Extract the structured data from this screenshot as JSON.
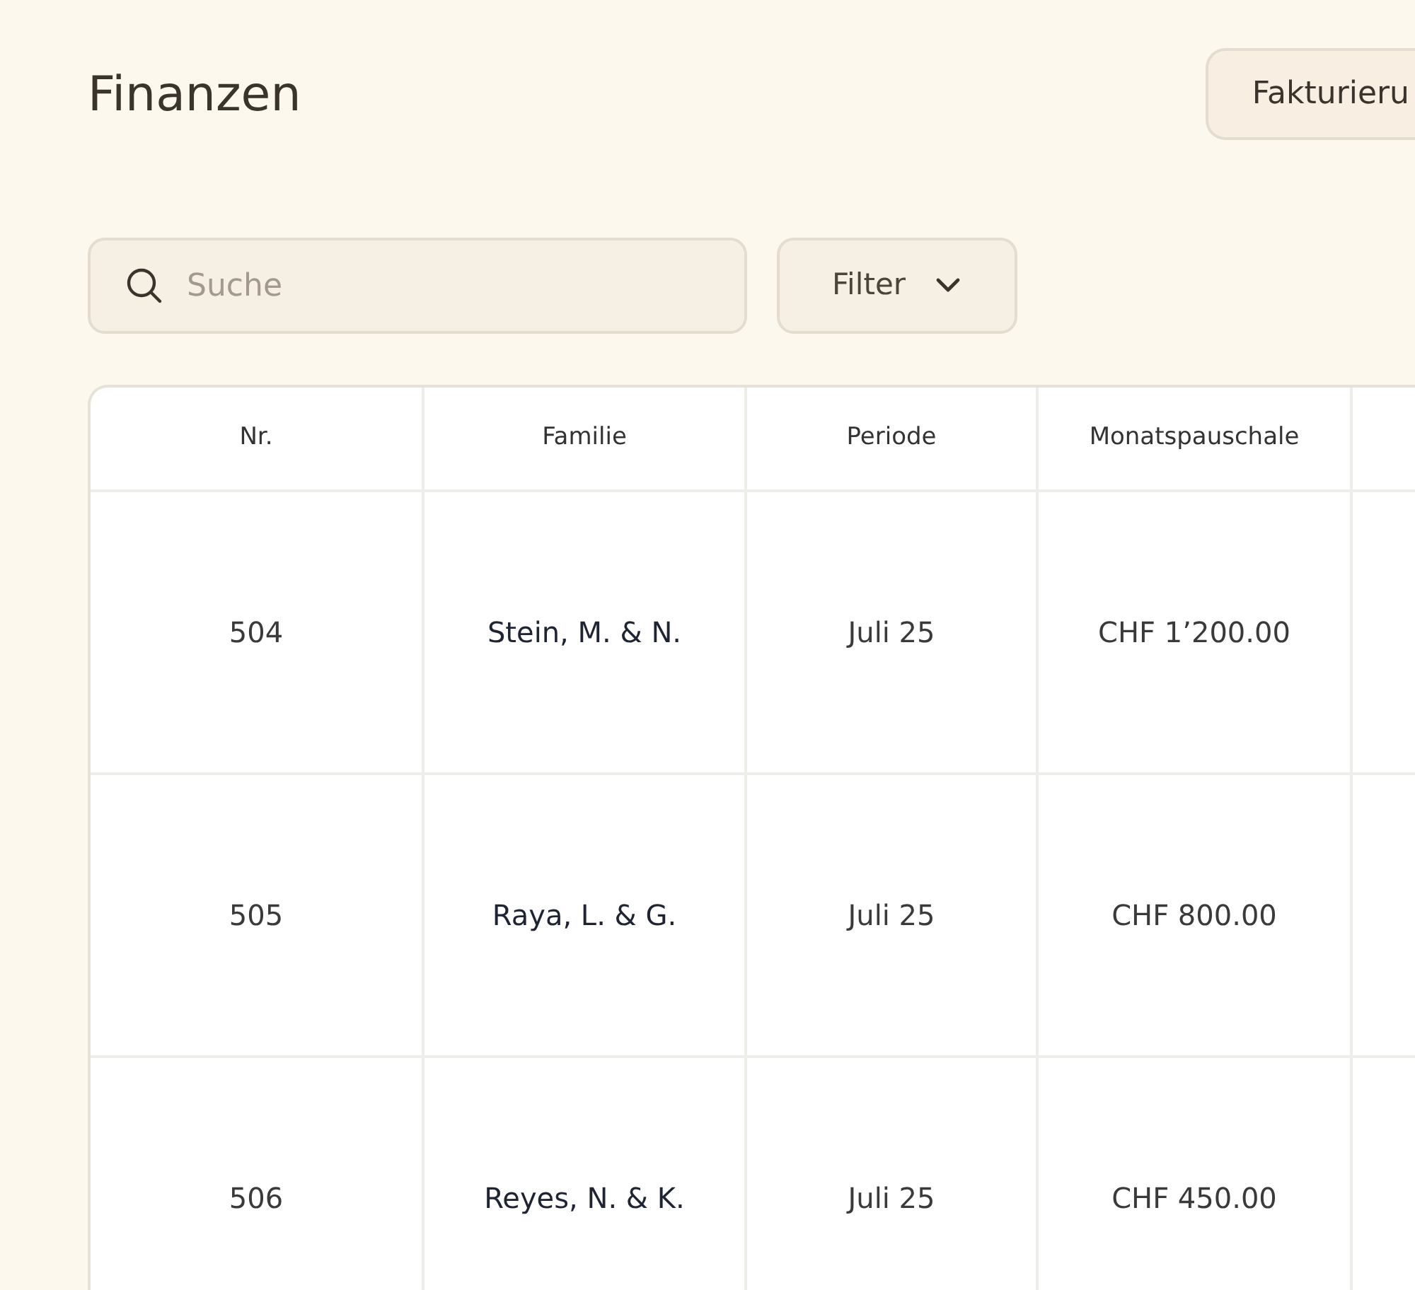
{
  "page": {
    "title": "Finanzen",
    "action_button": "Fakturieru"
  },
  "search": {
    "placeholder": "Suche"
  },
  "filter": {
    "label": "Filter"
  },
  "table": {
    "columns": [
      "Nr.",
      "Familie",
      "Periode",
      "Monatspauschale"
    ],
    "rows": [
      [
        "504",
        "Stein, M. & N.",
        "Juli 25",
        "CHF 1’200.00"
      ],
      [
        "505",
        "Raya, L. & G.",
        "Juli 25",
        "CHF 800.00"
      ],
      [
        "506",
        "Reyes, N. & K.",
        "Juli 25",
        "CHF 450.00"
      ]
    ]
  }
}
